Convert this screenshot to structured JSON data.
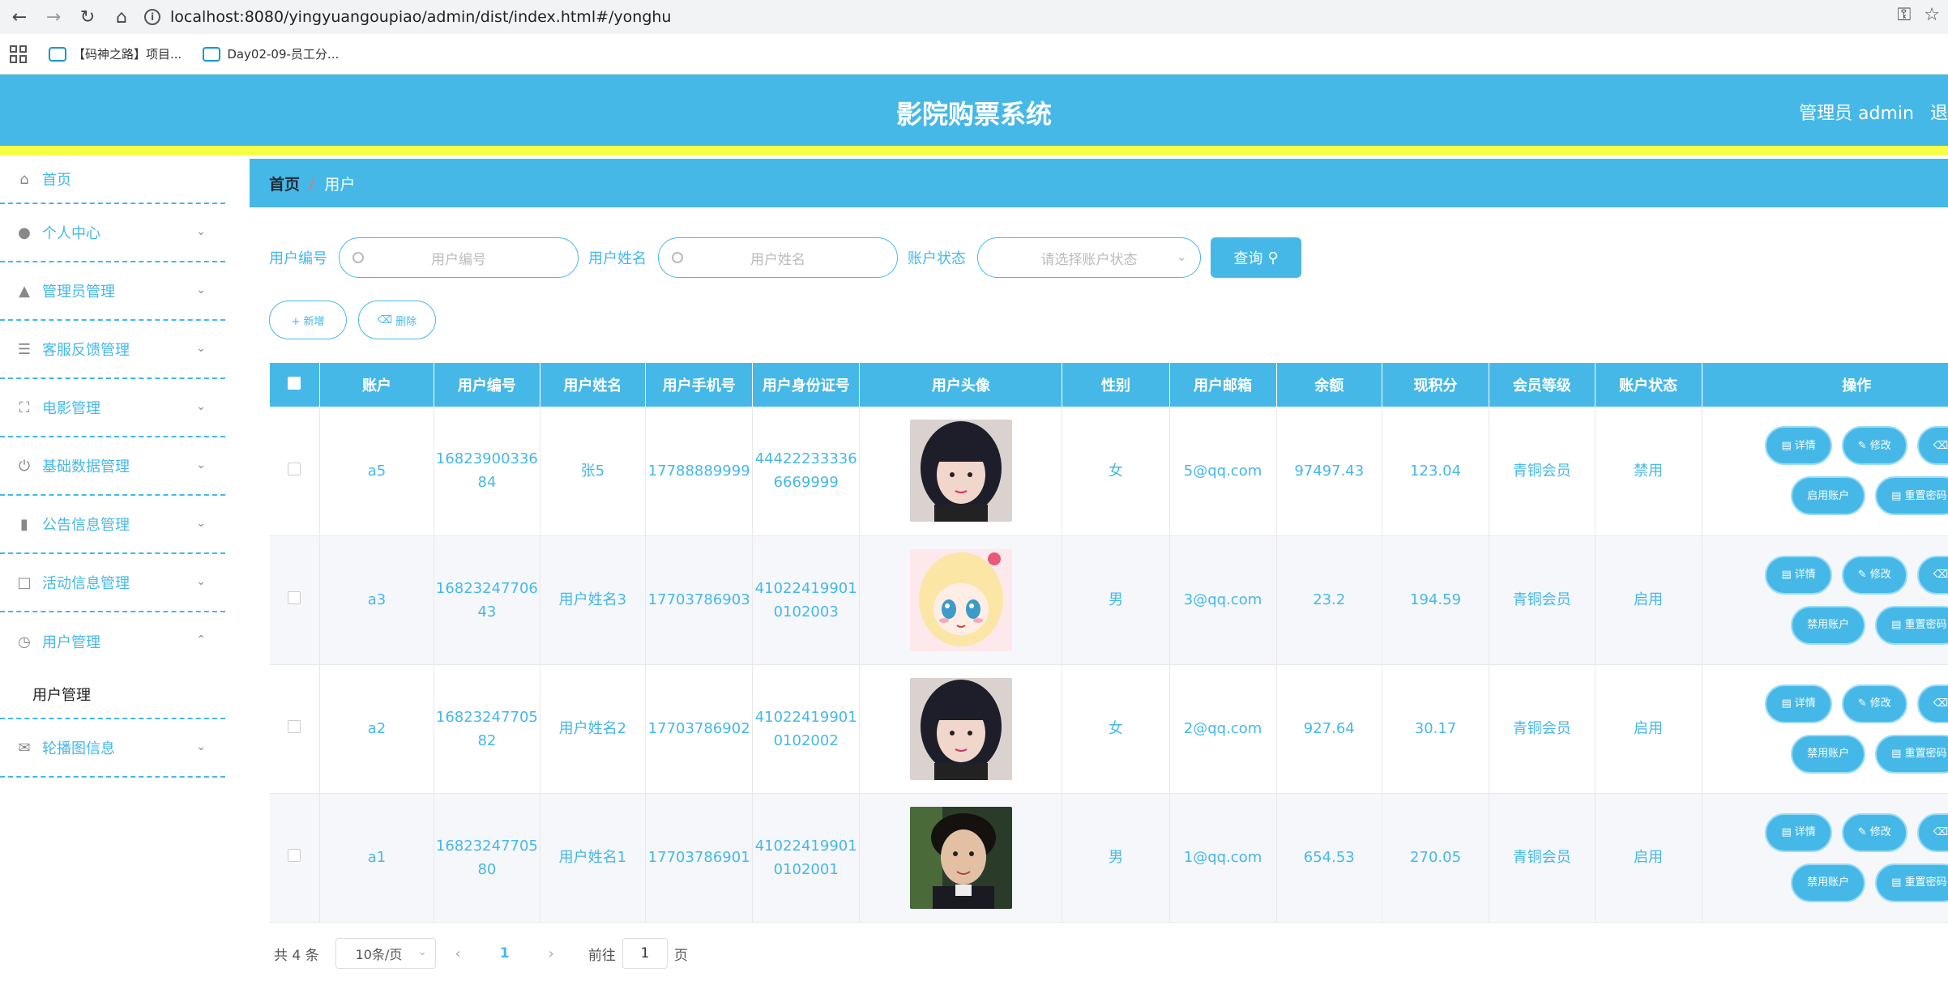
{
  "browser": {
    "url": "localhost:8080/yingyuangoupiao/admin/dist/index.html#/yonghu",
    "bookmarks": [
      "【码神之路】项目...",
      "Day02-09-员工分..."
    ]
  },
  "header": {
    "title": "影院购票系统",
    "user": "管理员 admin",
    "logout": "退"
  },
  "sidebar": {
    "items": [
      {
        "label": "首页",
        "icon": "home-icon"
      },
      {
        "label": "个人中心",
        "icon": "user-icon"
      },
      {
        "label": "管理员管理",
        "icon": "stamp-icon"
      },
      {
        "label": "客服反馈管理",
        "icon": "list-icon"
      },
      {
        "label": "电影管理",
        "icon": "fullscreen-icon"
      },
      {
        "label": "基础数据管理",
        "icon": "power-icon"
      },
      {
        "label": "公告信息管理",
        "icon": "mic-icon"
      },
      {
        "label": "活动信息管理",
        "icon": "crop-icon"
      },
      {
        "label": "用户管理",
        "icon": "clock-icon"
      },
      {
        "label": "轮播图信息",
        "icon": "chat-icon"
      }
    ],
    "sub_item": "用户管理"
  },
  "breadcrumb": {
    "home": "首页",
    "sep": "/",
    "current": "用户"
  },
  "search": {
    "label_id": "用户编号",
    "placeholder_id": "用户编号",
    "label_name": "用户姓名",
    "placeholder_name": "用户姓名",
    "label_status": "账户状态",
    "placeholder_status": "请选择账户状态",
    "query": "查询"
  },
  "actions": {
    "add": "+ 新增",
    "delete": "删除"
  },
  "table": {
    "headers": [
      "账户",
      "用户编号",
      "用户姓名",
      "用户手机号",
      "用户身份证号",
      "用户头像",
      "性别",
      "用户邮箱",
      "余额",
      "现积分",
      "会员等级",
      "账户状态",
      "操作"
    ],
    "rows": [
      {
        "account": "a5",
        "id": "1682390033684",
        "name": "张5",
        "phone": "17788889999",
        "idcard": "444222333366669999",
        "gender": "女",
        "email": "5@qq.com",
        "balance": "97497.43",
        "points": "123.04",
        "level": "青铜会员",
        "status": "禁用",
        "toggle": "启用账户",
        "avatar": "girl-dark-hair"
      },
      {
        "account": "a3",
        "id": "1682324770643",
        "name": "用户姓名3",
        "phone": "17703786903",
        "idcard": "410224199010102003",
        "gender": "男",
        "email": "3@qq.com",
        "balance": "23.2",
        "points": "194.59",
        "level": "青铜会员",
        "status": "启用",
        "toggle": "禁用账户",
        "avatar": "anime-girl"
      },
      {
        "account": "a2",
        "id": "1682324770582",
        "name": "用户姓名2",
        "phone": "17703786902",
        "idcard": "410224199010102002",
        "gender": "女",
        "email": "2@qq.com",
        "balance": "927.64",
        "points": "30.17",
        "level": "青铜会员",
        "status": "启用",
        "toggle": "禁用账户",
        "avatar": "girl-dark-hair"
      },
      {
        "account": "a1",
        "id": "1682324770580",
        "name": "用户姓名1",
        "phone": "17703786901",
        "idcard": "410224199010102001",
        "gender": "男",
        "email": "1@qq.com",
        "balance": "654.53",
        "points": "270.05",
        "level": "青铜会员",
        "status": "启用",
        "toggle": "禁用账户",
        "avatar": "young-man"
      }
    ],
    "ops": {
      "detail": "详情",
      "edit": "修改",
      "remove": "删除",
      "reset": "重置密码"
    }
  },
  "pager": {
    "total": "共 4 条",
    "size": "10条/页",
    "page": "1",
    "goto": "前往",
    "goto_value": "1",
    "unit": "页"
  },
  "colors": {
    "primary": "#46b8e8",
    "accent_bar": "#f6ff45"
  }
}
